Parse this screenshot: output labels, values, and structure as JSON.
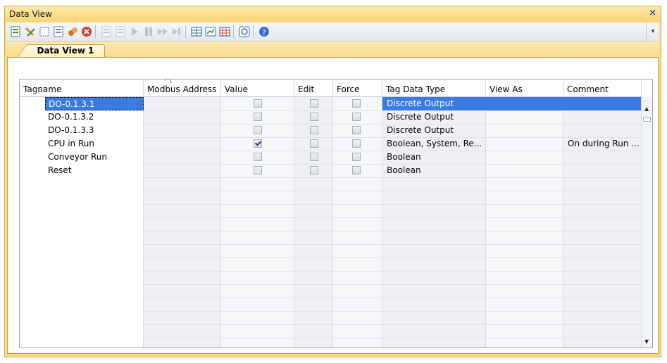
{
  "window": {
    "title": "Data View",
    "close_glyph": "×"
  },
  "toolbar": {
    "icons": [
      {
        "name": "new-view-icon",
        "color": "#3a8e3a"
      },
      {
        "name": "edit-view-icon",
        "color": "#d8862a"
      },
      {
        "name": "select-icon",
        "color": "#5a77b0"
      },
      {
        "name": "copy-icon",
        "color": "#6f86b4"
      },
      {
        "name": "find-icon",
        "color": "#c9762f"
      },
      {
        "name": "delete-icon",
        "color": "#d23b2d"
      },
      {
        "name": "page-icon",
        "color": "#9aa3b1"
      },
      {
        "name": "save-icon",
        "color": "#9aa3b1"
      },
      {
        "name": "run-icon",
        "color": "#9aa3b1"
      },
      {
        "name": "pause-icon",
        "color": "#9aa3b1"
      },
      {
        "name": "fast-forward-icon",
        "color": "#9aa3b1"
      },
      {
        "name": "step-icon",
        "color": "#9aa3b1"
      },
      {
        "name": "table-icon",
        "color": "#2b5fb0"
      },
      {
        "name": "chart-icon",
        "color": "#3c7fc8"
      },
      {
        "name": "grid-icon",
        "color": "#2a55a8"
      },
      {
        "name": "monitor-icon",
        "color": "#3c6fc0"
      },
      {
        "name": "help-icon",
        "color": "#3b6fd0"
      }
    ],
    "more_glyph": "▾"
  },
  "tabs": [
    {
      "label": "Data View 1"
    }
  ],
  "grid": {
    "sort_indicator": "^ 1",
    "columns": [
      "Tagname",
      "Modbus Address",
      "Value",
      "Edit",
      "Force",
      "Tag Data Type",
      "View As",
      "Comment"
    ],
    "rows": [
      {
        "tagname": "DO-0.1.3.1",
        "modbus": "",
        "value": false,
        "edit": false,
        "force": false,
        "type": "Discrete Output",
        "view_as": "",
        "comment": "",
        "selected": true
      },
      {
        "tagname": "DO-0.1.3.2",
        "modbus": "",
        "value": false,
        "edit": false,
        "force": false,
        "type": "Discrete Output",
        "view_as": "",
        "comment": "",
        "selected": false
      },
      {
        "tagname": "DO-0.1.3.3",
        "modbus": "",
        "value": false,
        "edit": false,
        "force": false,
        "type": "Discrete Output",
        "view_as": "",
        "comment": "",
        "selected": false
      },
      {
        "tagname": "CPU in Run",
        "modbus": "",
        "value": true,
        "edit": false,
        "force": false,
        "type": "Boolean, System, Re...",
        "view_as": "",
        "comment": "On during Run ...",
        "selected": false
      },
      {
        "tagname": "Conveyor Run",
        "modbus": "",
        "value": false,
        "edit": false,
        "force": false,
        "type": "Boolean",
        "view_as": "",
        "comment": "",
        "selected": false
      },
      {
        "tagname": "Reset",
        "modbus": "",
        "value": false,
        "edit": false,
        "force": false,
        "type": "Boolean",
        "view_as": "",
        "comment": "",
        "selected": false
      }
    ]
  },
  "scrollbar": {
    "up_glyph": "▲",
    "down_glyph": "▼"
  },
  "colors": {
    "selection": "#3b7be0",
    "frame": "#fbd98a",
    "alt_column": "#eef0f3"
  }
}
